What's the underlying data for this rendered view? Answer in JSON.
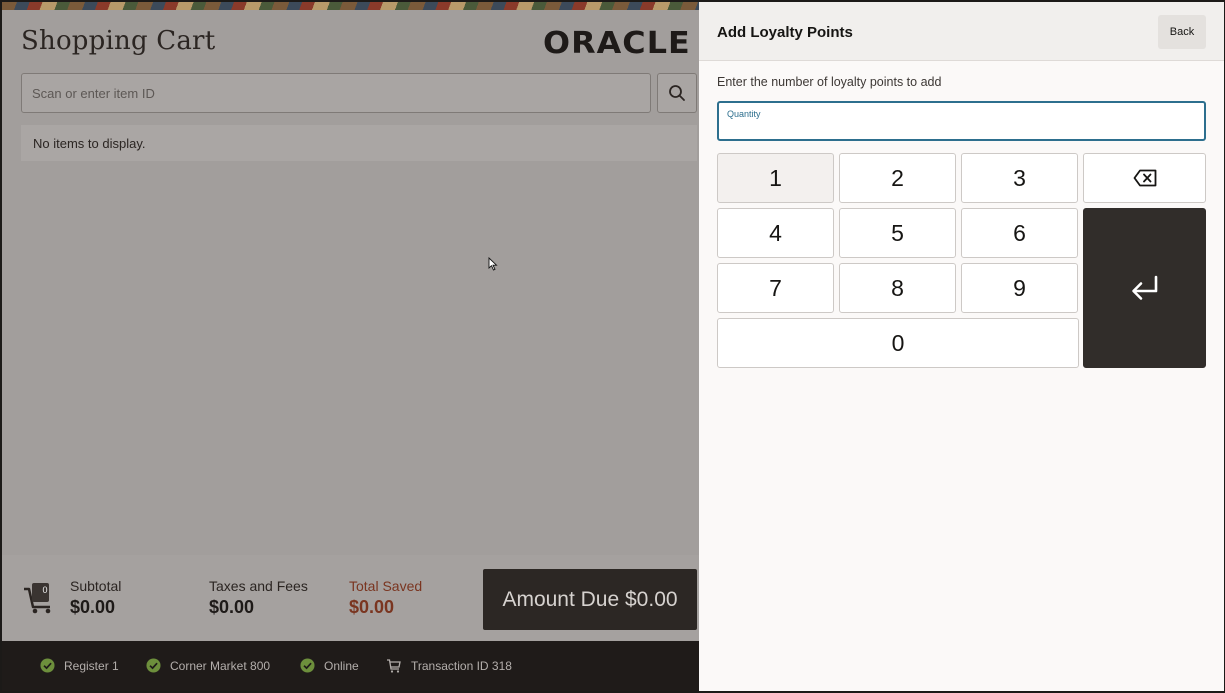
{
  "cart": {
    "title": "Shopping Cart",
    "logo_text": "ORACLE",
    "search_placeholder": "Scan or enter item ID",
    "empty_message": "No items to display.",
    "item_count": "0"
  },
  "totals": {
    "subtotal_label": "Subtotal",
    "subtotal_value": "$0.00",
    "taxes_label": "Taxes and Fees",
    "taxes_value": "$0.00",
    "saved_label": "Total Saved",
    "saved_value": "$0.00",
    "amount_due": "Amount Due $0.00"
  },
  "status": {
    "register": "Register 1",
    "store": "Corner Market 800",
    "connection": "Online",
    "transaction": "Transaction ID 318"
  },
  "panel": {
    "title": "Add Loyalty Points",
    "back_label": "Back",
    "instruction": "Enter the number of loyalty points to add",
    "quantity_label": "Quantity",
    "quantity_value": ""
  },
  "keypad": {
    "k1": "1",
    "k2": "2",
    "k3": "3",
    "k4": "4",
    "k5": "5",
    "k6": "6",
    "k7": "7",
    "k8": "8",
    "k9": "9",
    "k0": "0"
  },
  "colors": {
    "accent": "#2d6f8e",
    "saved": "#7a3520",
    "dark_button": "#312d2a",
    "status_ok": "#6d8f3c"
  },
  "icons": {
    "search": "search-icon",
    "cart": "cart-icon",
    "check": "check-circle-icon",
    "backspace": "backspace-icon",
    "enter": "enter-icon"
  }
}
